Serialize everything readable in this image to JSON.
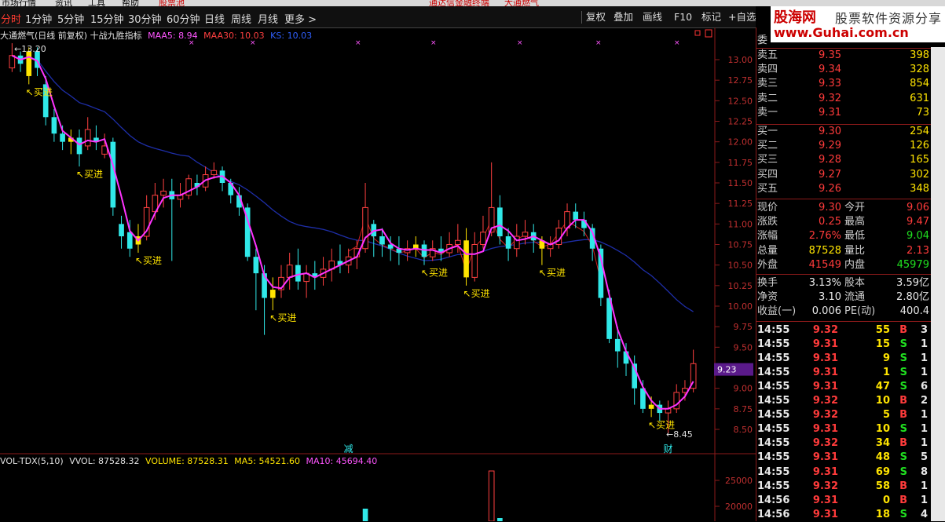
{
  "menu": [
    "市场行情",
    "资讯",
    "工具",
    "帮助",
    "股票池",
    "通达信金融终端",
    "大通燃气"
  ],
  "periods": [
    {
      "label": "分时",
      "active": true
    },
    {
      "label": "1分钟"
    },
    {
      "label": "5分钟"
    },
    {
      "label": "15分钟"
    },
    {
      "label": "30分钟"
    },
    {
      "label": "60分钟"
    },
    {
      "label": "日线"
    },
    {
      "label": "周线"
    },
    {
      "label": "月线"
    },
    {
      "label": "更多 >"
    }
  ],
  "toolbar_buttons": [
    "复权",
    "叠加",
    "画线",
    "F10",
    "标记",
    "+自选"
  ],
  "chart_title": {
    "stock": "大通燃气(日线 前复权) 十战九胜指标",
    "maa5": "MAA5: 8.94",
    "maa30": "MAA30: 10.03",
    "ks": "KS: 10.03"
  },
  "vol_title": {
    "ind": "VOL-TDX(5,10)",
    "vvol": "VVOL: 87528.32",
    "volume": "VOLUME: 87528.31",
    "ma5": "MA5: 54521.60",
    "ma10": "MA10: 45694.40"
  },
  "chart_data": {
    "type": "candlestick",
    "price_axis": {
      "min": 8.5,
      "max": 13.0,
      "ticks": [
        "13.00",
        "12.75",
        "12.50",
        "12.25",
        "12.00",
        "11.75",
        "11.50",
        "11.25",
        "11.00",
        "10.75",
        "10.50",
        "10.25",
        "10.00",
        "9.75",
        "9.50",
        "9.25",
        "9.00",
        "8.75",
        "8.50"
      ]
    },
    "volume_axis_ticks": [
      "25000",
      "20000"
    ],
    "current_price_tag": "9.23",
    "high_label": "13.20",
    "low_label": "8.45",
    "annotations": [
      {
        "text": "买进",
        "at": 2
      },
      {
        "text": "买进",
        "at": 8
      },
      {
        "text": "买进",
        "at": 15
      },
      {
        "text": "买进",
        "at": 31
      },
      {
        "text": "买进",
        "at": 49
      },
      {
        "text": "买进",
        "at": 54
      },
      {
        "text": "买进",
        "at": 63
      },
      {
        "text": "买进",
        "at": 76
      }
    ],
    "markers": [
      {
        "text": "减",
        "at": 40
      },
      {
        "text": "财",
        "at": 78
      }
    ],
    "candles": [
      [
        12.9,
        13.05,
        13.2,
        12.85
      ],
      [
        13.05,
        12.95,
        13.1,
        12.85
      ],
      [
        12.8,
        13.1,
        13.15,
        12.7
      ],
      [
        13.1,
        12.9,
        13.15,
        12.8
      ],
      [
        12.7,
        12.3,
        12.8,
        12.2
      ],
      [
        12.3,
        12.1,
        12.4,
        12.0
      ],
      [
        12.1,
        12.0,
        12.2,
        11.9
      ],
      [
        12.0,
        12.05,
        12.15,
        11.85
      ],
      [
        12.05,
        11.85,
        12.15,
        11.7
      ],
      [
        11.95,
        12.15,
        12.3,
        11.9
      ],
      [
        12.05,
        12.0,
        12.2,
        11.9
      ],
      [
        11.85,
        11.95,
        12.1,
        11.8
      ],
      [
        12.0,
        11.2,
        12.05,
        11.1
      ],
      [
        11.0,
        10.85,
        11.1,
        10.7
      ],
      [
        10.9,
        10.7,
        11.05,
        10.6
      ],
      [
        10.75,
        10.85,
        11.0,
        10.65
      ],
      [
        10.85,
        11.2,
        11.35,
        10.8
      ],
      [
        11.15,
        11.35,
        11.5,
        11.05
      ],
      [
        11.35,
        11.4,
        11.55,
        11.2
      ],
      [
        11.4,
        11.3,
        11.55,
        10.55
      ],
      [
        11.3,
        11.35,
        11.5,
        11.2
      ],
      [
        11.35,
        11.55,
        11.6,
        11.3
      ],
      [
        11.5,
        11.45,
        11.6,
        11.35
      ],
      [
        11.45,
        11.6,
        11.7,
        11.4
      ],
      [
        11.6,
        11.65,
        11.75,
        11.55
      ],
      [
        11.65,
        11.5,
        11.7,
        11.4
      ],
      [
        11.5,
        11.35,
        11.55,
        11.25
      ],
      [
        11.35,
        11.2,
        11.45,
        11.1
      ],
      [
        11.2,
        10.6,
        11.25,
        10.55
      ],
      [
        10.6,
        10.4,
        10.7,
        9.95
      ],
      [
        10.4,
        10.1,
        10.5,
        9.65
      ],
      [
        10.1,
        10.2,
        10.35,
        9.95
      ],
      [
        10.2,
        10.35,
        10.5,
        10.1
      ],
      [
        10.35,
        10.5,
        10.65,
        10.2
      ],
      [
        10.5,
        10.3,
        10.7,
        10.2
      ],
      [
        10.3,
        10.4,
        10.5,
        10.1
      ],
      [
        10.4,
        10.35,
        10.55,
        10.2
      ],
      [
        10.35,
        10.45,
        10.6,
        10.25
      ],
      [
        10.45,
        10.55,
        10.7,
        10.3
      ],
      [
        10.55,
        10.5,
        10.75,
        10.4
      ],
      [
        10.5,
        10.6,
        10.7,
        10.4
      ],
      [
        10.6,
        10.7,
        10.8,
        10.45
      ],
      [
        10.7,
        11.2,
        11.5,
        10.65
      ],
      [
        11.0,
        10.85,
        11.05,
        10.6
      ],
      [
        10.85,
        10.75,
        10.95,
        10.6
      ],
      [
        10.75,
        10.7,
        10.85,
        10.55
      ],
      [
        10.7,
        10.65,
        10.85,
        10.5
      ],
      [
        10.65,
        10.7,
        10.8,
        10.55
      ],
      [
        10.7,
        10.75,
        10.85,
        10.6
      ],
      [
        10.75,
        10.6,
        10.8,
        10.5
      ],
      [
        10.6,
        10.7,
        10.8,
        10.55
      ],
      [
        10.7,
        10.65,
        10.85,
        10.55
      ],
      [
        10.65,
        10.75,
        10.9,
        10.6
      ],
      [
        10.75,
        10.8,
        11.0,
        10.65
      ],
      [
        10.8,
        10.35,
        10.95,
        10.25
      ],
      [
        10.35,
        10.75,
        10.9,
        10.3
      ],
      [
        10.75,
        10.9,
        11.1,
        10.7
      ],
      [
        10.9,
        11.2,
        11.75,
        10.85
      ],
      [
        11.2,
        10.85,
        11.35,
        10.75
      ],
      [
        10.85,
        10.7,
        10.95,
        10.55
      ],
      [
        10.7,
        10.85,
        11.0,
        10.6
      ],
      [
        10.85,
        10.9,
        11.05,
        10.75
      ],
      [
        10.9,
        10.8,
        11.0,
        10.65
      ],
      [
        10.8,
        10.7,
        10.85,
        10.5
      ],
      [
        10.7,
        10.75,
        10.85,
        10.6
      ],
      [
        10.75,
        10.95,
        11.05,
        10.7
      ],
      [
        10.95,
        11.15,
        11.25,
        10.85
      ],
      [
        11.15,
        11.05,
        11.25,
        10.95
      ],
      [
        11.05,
        10.95,
        11.15,
        10.85
      ],
      [
        10.95,
        10.7,
        11.0,
        10.55
      ],
      [
        10.7,
        10.1,
        10.75,
        10.0
      ],
      [
        10.1,
        9.6,
        10.2,
        9.55
      ],
      [
        9.6,
        9.45,
        9.75,
        9.25
      ],
      [
        9.45,
        9.3,
        9.55,
        9.15
      ],
      [
        9.3,
        9.0,
        9.4,
        8.8
      ],
      [
        9.0,
        8.75,
        9.1,
        8.7
      ],
      [
        8.75,
        8.8,
        8.9,
        8.65
      ],
      [
        8.8,
        8.7,
        8.85,
        8.6
      ],
      [
        8.7,
        8.75,
        8.85,
        8.45
      ],
      [
        8.75,
        8.95,
        9.05,
        8.7
      ],
      [
        8.95,
        9.0,
        9.1,
        8.85
      ],
      [
        9.0,
        9.3,
        9.47,
        8.95
      ]
    ]
  },
  "quote": {
    "header": "委",
    "asks": [
      {
        "label": "卖五",
        "price": "9.35",
        "vol": "398"
      },
      {
        "label": "卖四",
        "price": "9.34",
        "vol": "328"
      },
      {
        "label": "卖三",
        "price": "9.33",
        "vol": "854"
      },
      {
        "label": "卖二",
        "price": "9.32",
        "vol": "631"
      },
      {
        "label": "卖一",
        "price": "9.31",
        "vol": "73"
      }
    ],
    "bids": [
      {
        "label": "买一",
        "price": "9.30",
        "vol": "254"
      },
      {
        "label": "买二",
        "price": "9.29",
        "vol": "126"
      },
      {
        "label": "买三",
        "price": "9.28",
        "vol": "165"
      },
      {
        "label": "买四",
        "price": "9.27",
        "vol": "302"
      },
      {
        "label": "买五",
        "price": "9.26",
        "vol": "348"
      }
    ],
    "stats": [
      {
        "l1": "现价",
        "v1": "9.30",
        "c1": "redv",
        "l2": "今开",
        "v2": "9.06",
        "c2": "redv"
      },
      {
        "l1": "涨跌",
        "v1": "0.25",
        "c1": "redv",
        "l2": "最高",
        "v2": "9.47",
        "c2": "redv"
      },
      {
        "l1": "涨幅",
        "v1": "2.76%",
        "c1": "redv",
        "l2": "最低",
        "v2": "9.04",
        "c2": "greenv"
      },
      {
        "l1": "总量",
        "v1": "87528",
        "c1": "yellowv",
        "l2": "量比",
        "v2": "2.13",
        "c2": "redv"
      },
      {
        "l1": "外盘",
        "v1": "41549",
        "c1": "redv",
        "l2": "内盘",
        "v2": "45979",
        "c2": "greenv"
      }
    ],
    "finance": [
      {
        "l1": "换手",
        "v1": "3.13%",
        "l2": "股本",
        "v2": "3.59亿"
      },
      {
        "l1": "净资",
        "v1": "3.10",
        "l2": "流通",
        "v2": "2.80亿"
      },
      {
        "l1": "收益(一)",
        "v1": "0.006",
        "l2": "PE(动)",
        "v2": "400.4"
      }
    ],
    "ticks": [
      {
        "t": "14:55",
        "p": "9.32",
        "v": "55",
        "s": "B",
        "n": "3"
      },
      {
        "t": "14:55",
        "p": "9.31",
        "v": "15",
        "s": "S",
        "n": "1"
      },
      {
        "t": "14:55",
        "p": "9.31",
        "v": "9",
        "s": "S",
        "n": "1"
      },
      {
        "t": "14:55",
        "p": "9.31",
        "v": "1",
        "s": "S",
        "n": "1"
      },
      {
        "t": "14:55",
        "p": "9.31",
        "v": "47",
        "s": "S",
        "n": "6"
      },
      {
        "t": "14:55",
        "p": "9.32",
        "v": "10",
        "s": "B",
        "n": "2"
      },
      {
        "t": "14:55",
        "p": "9.32",
        "v": "5",
        "s": "B",
        "n": "1"
      },
      {
        "t": "14:55",
        "p": "9.31",
        "v": "10",
        "s": "S",
        "n": "1"
      },
      {
        "t": "14:55",
        "p": "9.32",
        "v": "34",
        "s": "B",
        "n": "1"
      },
      {
        "t": "14:55",
        "p": "9.31",
        "v": "48",
        "s": "S",
        "n": "5"
      },
      {
        "t": "14:55",
        "p": "9.31",
        "v": "69",
        "s": "S",
        "n": "8"
      },
      {
        "t": "14:55",
        "p": "9.32",
        "v": "58",
        "s": "B",
        "n": "1"
      },
      {
        "t": "14:56",
        "p": "9.31",
        "v": "0",
        "s": "B",
        "n": "1"
      },
      {
        "t": "14:56",
        "p": "9.31",
        "v": "18",
        "s": "S",
        "n": "4"
      }
    ]
  },
  "logo": {
    "line1": "股海网",
    "line1b": "股票软件资源分享",
    "line2": "www.Guhai.com.cn"
  }
}
